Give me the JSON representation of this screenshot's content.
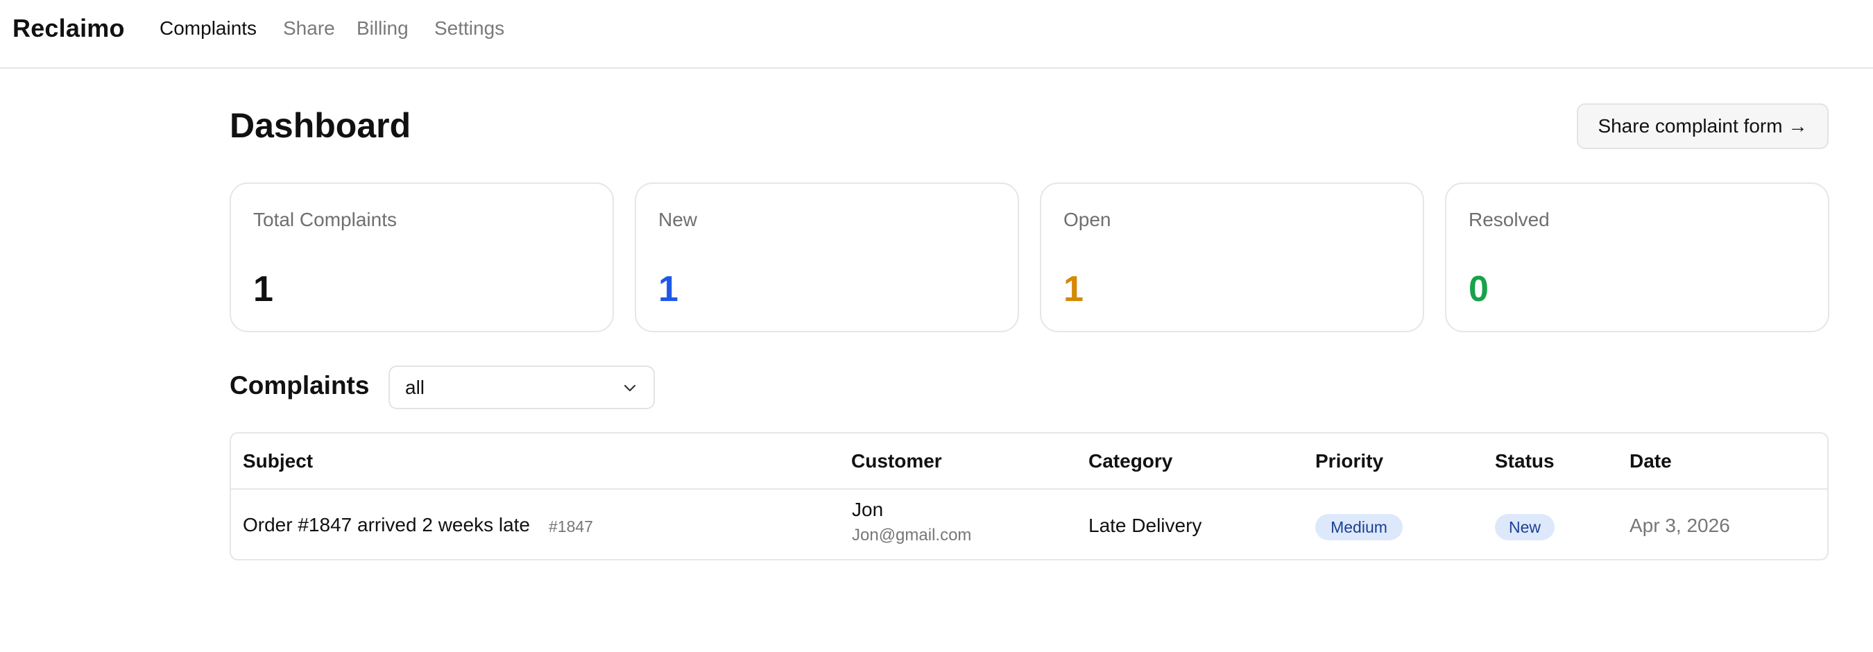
{
  "nav": {
    "brand": "Reclaimo",
    "links": [
      {
        "label": "Complaints",
        "active": true
      },
      {
        "label": "Share",
        "active": false
      },
      {
        "label": "Billing",
        "active": false
      },
      {
        "label": "Settings",
        "active": false
      }
    ]
  },
  "header": {
    "title": "Dashboard",
    "share_button": "Share complaint form",
    "share_arrow": "→"
  },
  "stats": [
    {
      "label": "Total Complaints",
      "value": "1",
      "color": "#111111"
    },
    {
      "label": "New",
      "value": "1",
      "color": "#1f57e6"
    },
    {
      "label": "Open",
      "value": "1",
      "color": "#d48806"
    },
    {
      "label": "Resolved",
      "value": "0",
      "color": "#16a34a"
    }
  ],
  "complaints": {
    "title": "Complaints",
    "filter": {
      "selected": "all",
      "icon": "chevron-down-icon"
    },
    "columns": [
      "Subject",
      "Customer",
      "Category",
      "Priority",
      "Status",
      "Date"
    ],
    "rows": [
      {
        "subject": "Order #1847 arrived 2 weeks late",
        "ref": "#1847",
        "customer_name": "Jon",
        "customer_email": "Jon@gmail.com",
        "category": "Late Delivery",
        "priority": "Medium",
        "status": "New",
        "date": "Apr 3, 2026"
      }
    ]
  }
}
